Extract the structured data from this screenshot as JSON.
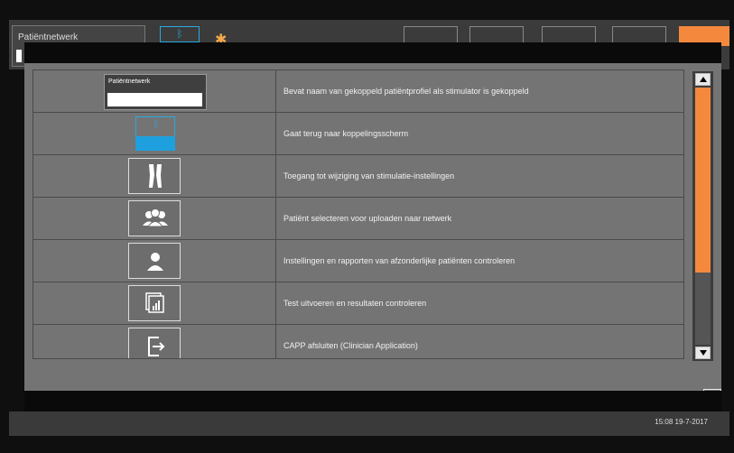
{
  "app": {
    "profile_label": "Patiëntnetwerk",
    "link_label": "ᛒ",
    "timestamp": "15:08 19-7-2017"
  },
  "help_dialog": {
    "rows": [
      {
        "icon": "patient-network-field",
        "icon_label": "Patiëntnetwerk",
        "description": "Bevat naam van gekoppeld patiëntprofiel als stimulator is gekoppeld"
      },
      {
        "icon": "bluetooth-link-icon",
        "icon_label": "ᛒ",
        "description": "Gaat terug naar koppelingsscherm"
      },
      {
        "icon": "legs-icon",
        "description": "Toegang tot wijziging van stimulatie-instellingen"
      },
      {
        "icon": "patient-group-icon",
        "description": "Patiënt selecteren voor uploaden naar netwerk"
      },
      {
        "icon": "single-patient-icon",
        "description": "Instellingen en rapporten van afzonderlijke patiënten controleren"
      },
      {
        "icon": "test-results-icon",
        "description": "Test uitvoeren en resultaten controleren"
      },
      {
        "icon": "exit-icon",
        "description": "CAPP afsluiten (Clinician Application)"
      }
    ],
    "scroll_position": 0.0,
    "scroll_visible_fraction": 0.72,
    "colors": {
      "accent": "#f4893e",
      "link_blue": "#1ea0de"
    }
  }
}
